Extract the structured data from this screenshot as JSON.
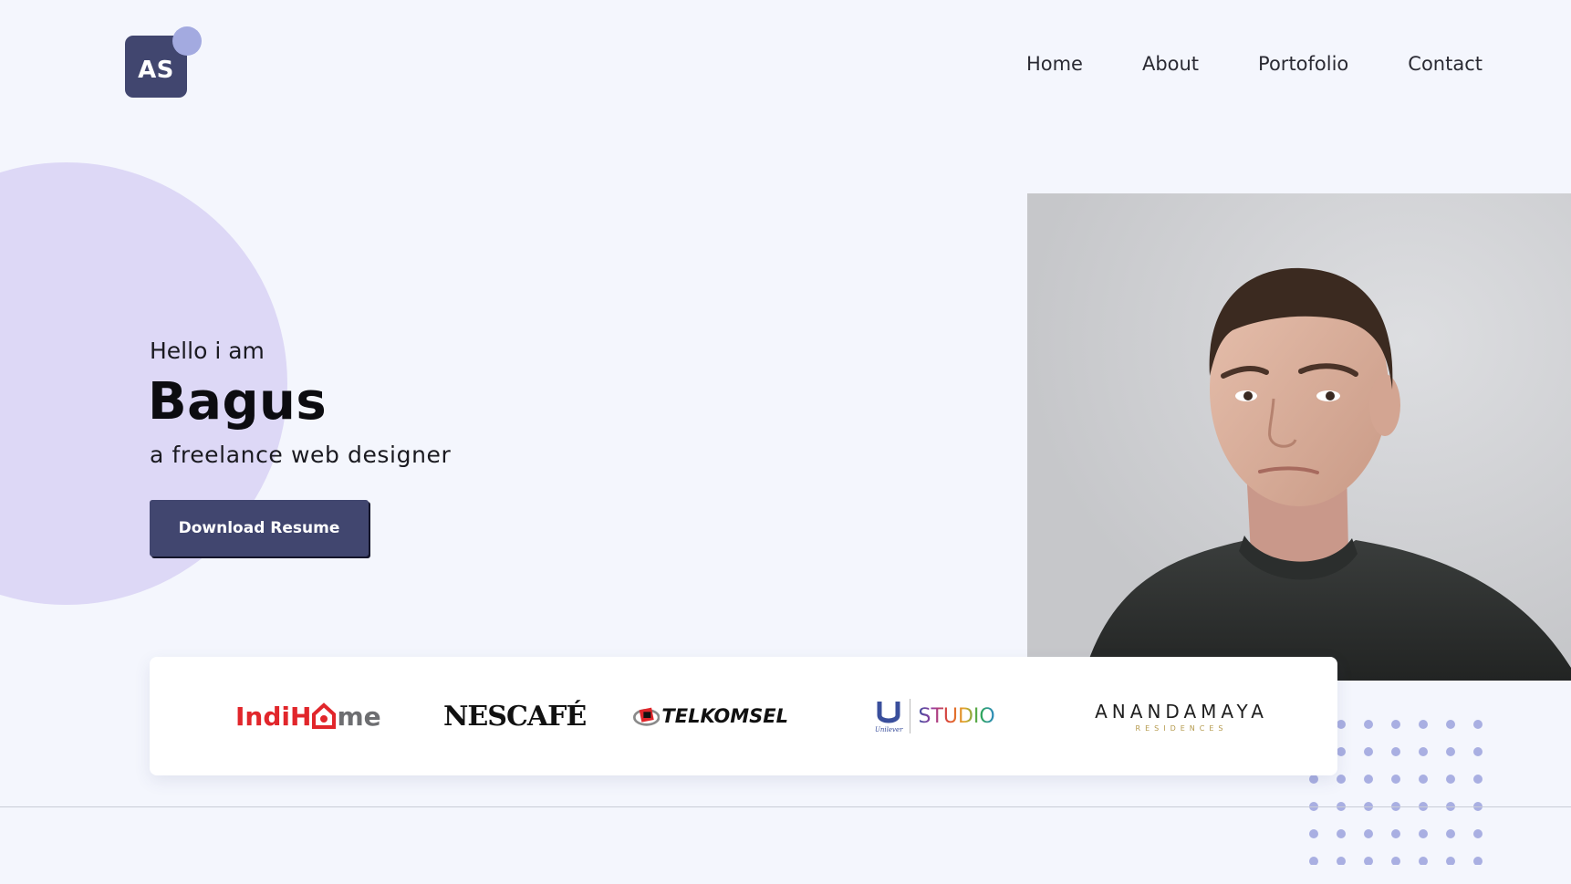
{
  "logo": {
    "initials": "AS"
  },
  "nav": {
    "items": [
      {
        "label": "Home"
      },
      {
        "label": "About"
      },
      {
        "label": "Portofolio"
      },
      {
        "label": "Contact"
      }
    ]
  },
  "hero": {
    "greeting": "Hello i am",
    "name": "Bagus",
    "tagline": "a freelance web designer",
    "cta_label": "Download Resume"
  },
  "brands": [
    {
      "name": "IndiHome",
      "part1": "Indi",
      "part2": "H",
      "part3": "me",
      "icon": "house-icon"
    },
    {
      "name": "NESCAFÉ",
      "text": "NESCAFÉ"
    },
    {
      "name": "TELKOMSEL",
      "text": "TELKOMSEL",
      "icon": "telkomsel-icon"
    },
    {
      "name": "U STUDIO",
      "text": "STUDIO",
      "sub": "Unilever",
      "icon": "unilever-icon"
    },
    {
      "name": "ANANDAMAYA",
      "text": "ANANDAMAYA",
      "sub": "RESIDENCES"
    }
  ],
  "colors": {
    "background": "#f4f6fd",
    "accent": "#41466f",
    "circle": "#ddd8f6",
    "logo_dot": "#a3aae0",
    "dots": "#a9afe2"
  }
}
